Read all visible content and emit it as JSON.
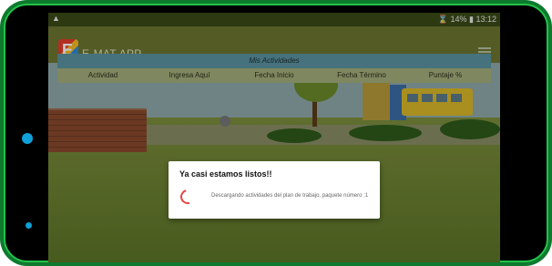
{
  "status_bar": {
    "warning_icon": "warning-icon",
    "battery_text": "14%",
    "time": "13:12"
  },
  "app_bar": {
    "logo_letter": "E",
    "title": "E-MAT APP",
    "menu_icon": "menu-icon"
  },
  "activities_header": {
    "title": "Mis Actividades",
    "columns": [
      "Actividad",
      "Ingresa Aquí",
      "Fecha Inicio",
      "Fecha Término",
      "Puntaje %"
    ]
  },
  "dialog": {
    "title": "Ya casi estamos listos!!",
    "message": "Descargando actividades del plan de trabajo, paquete número :1",
    "spinner_color": "#e64545"
  },
  "colors": {
    "device_frame": "#0e7a2e",
    "device_border": "#22c24a",
    "app_bar": "#6c7530",
    "header_title_bg": "#5a92a1",
    "header_cols_bg": "#a3ad7c"
  }
}
